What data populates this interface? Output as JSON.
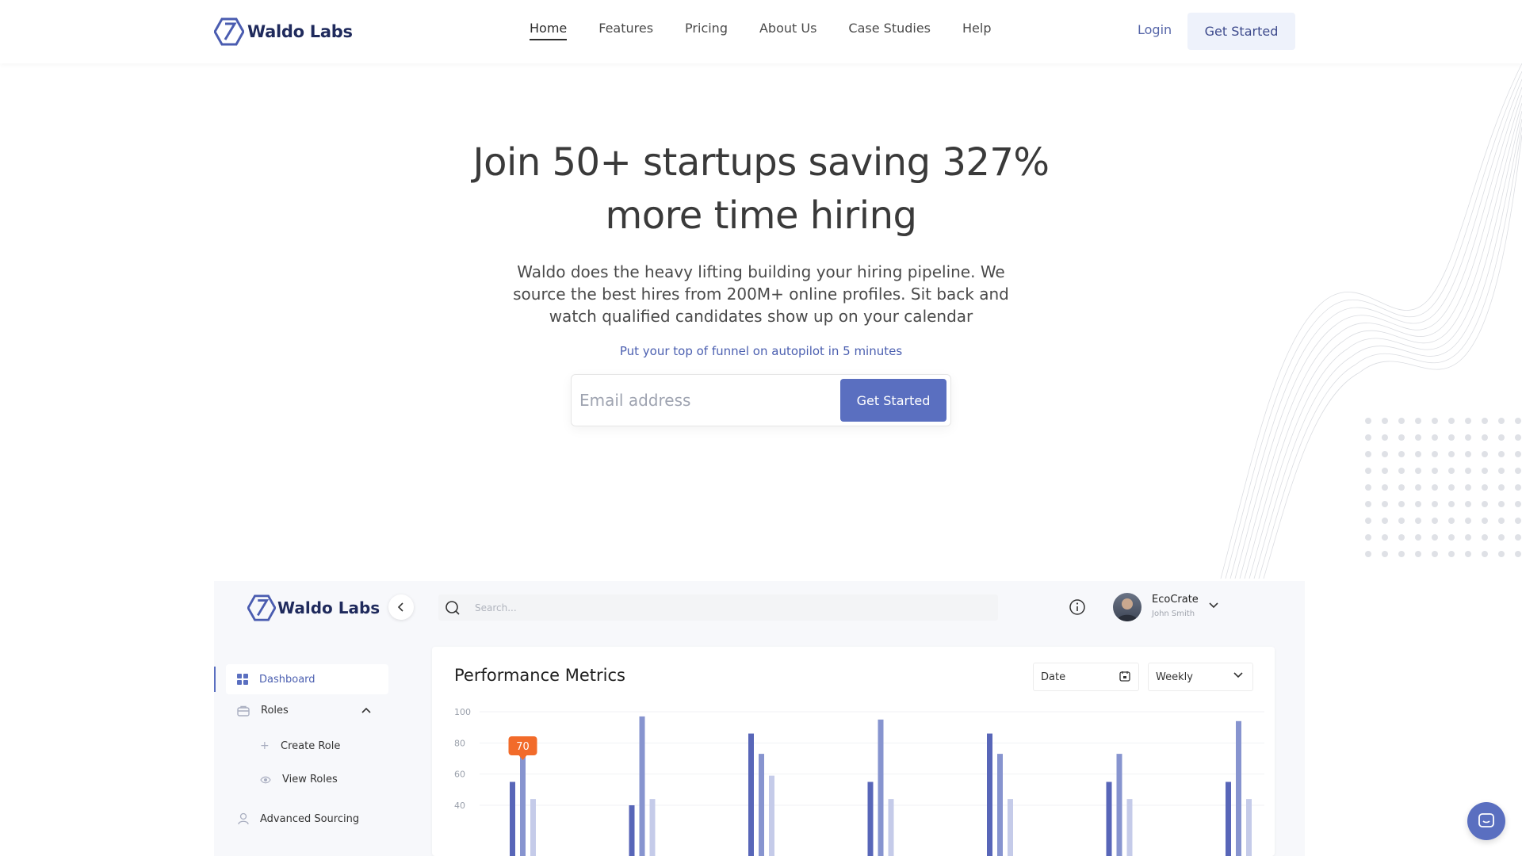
{
  "brand": {
    "name": "Waldo Labs"
  },
  "nav": {
    "links": [
      "Home",
      "Features",
      "Pricing",
      "About Us",
      "Case Studies",
      "Help"
    ],
    "login": "Login",
    "cta": "Get Started"
  },
  "hero": {
    "title_line1": "Join 50+ startups saving 327%",
    "title_line2": "more time hiring",
    "subtitle": "Waldo does the heavy lifting building your hiring pipeline. We source the best hires from 200M+ online profiles. Sit back and watch qualified candidates show up on your calendar",
    "tagline": "Put your top of funnel on autopilot in 5 minutes",
    "email_placeholder": "Email address",
    "cta": "Get Started"
  },
  "dashboard": {
    "brand": "Waldo Labs",
    "search_placeholder": "Search...",
    "user": {
      "company": "EcoCrate",
      "name": "John Smith"
    },
    "sidebar": [
      {
        "label": "Dashboard"
      },
      {
        "label": "Roles"
      },
      {
        "label": "Create Role"
      },
      {
        "label": "View Roles"
      },
      {
        "label": "Advanced Sourcing"
      }
    ],
    "card": {
      "title": "Performance Metrics",
      "date_label": "Date",
      "period_label": "Weekly",
      "tooltip_value": "70"
    }
  },
  "colors": {
    "accent": "#5a6fc0",
    "brand_dark": "#1f2a5c",
    "tooltip": "#f26b2a",
    "bar_dark": "#5866b8",
    "bar_mid": "#8794cf",
    "bar_light": "#c5cbe9"
  },
  "chart_data": {
    "type": "bar",
    "y_ticks": [
      100,
      80,
      60,
      40
    ],
    "ylim": [
      0,
      100
    ],
    "groups": 7,
    "series": [
      {
        "values": [
          55,
          40,
          86,
          55,
          86,
          55,
          55
        ]
      },
      {
        "values": [
          73,
          97,
          73,
          95,
          73,
          73,
          94
        ]
      },
      {
        "values": [
          44,
          44,
          59,
          44,
          44,
          44,
          44
        ]
      }
    ],
    "highlight": {
      "group": 0,
      "series": 1,
      "value": 70
    }
  }
}
